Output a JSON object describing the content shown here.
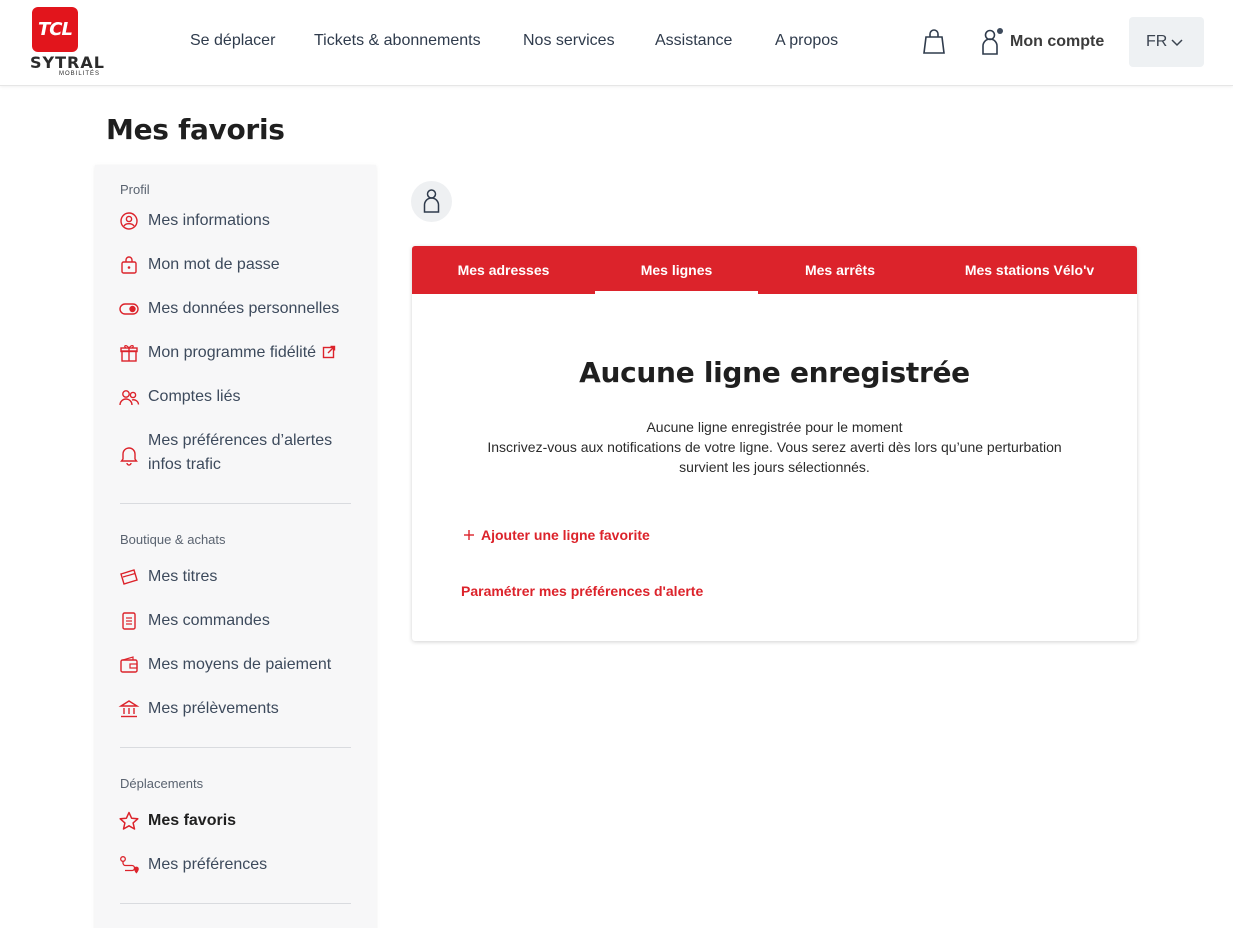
{
  "header": {
    "logo": {
      "badge": "TCL",
      "name": "SYTRAL",
      "sub": "MOBILITÉS"
    },
    "nav": [
      "Se déplacer",
      "Tickets & abonnements",
      "Nos services",
      "Assistance",
      "A propos"
    ],
    "account_label": "Mon compte",
    "lang": "FR",
    "icons": {
      "cart": "shopping-bag-icon",
      "account": "user-icon",
      "lang": "chevron-down-icon"
    }
  },
  "page": {
    "title": "Mes favoris"
  },
  "sidebar": {
    "sections": [
      {
        "label": "Profil",
        "items": [
          {
            "label": "Mes informations",
            "icon": "user-circle-icon"
          },
          {
            "label": "Mon mot de passe",
            "icon": "lock-icon"
          },
          {
            "label": "Mes données personnelles",
            "icon": "toggle-icon"
          },
          {
            "label": "Mon programme fidélité",
            "icon": "gift-icon",
            "external": true
          },
          {
            "label": "Comptes liés",
            "icon": "users-icon"
          },
          {
            "label": "Mes préférences d’alertes infos trafic",
            "line1": "Mes préférences d’alertes",
            "line2": "infos trafic",
            "icon": "bell-icon"
          }
        ]
      },
      {
        "label": "Boutique & achats",
        "items": [
          {
            "label": "Mes titres",
            "icon": "ticket-icon"
          },
          {
            "label": "Mes commandes",
            "icon": "receipt-icon"
          },
          {
            "label": "Mes moyens de paiement",
            "icon": "wallet-icon"
          },
          {
            "label": "Mes prélèvements",
            "icon": "bank-icon"
          }
        ]
      },
      {
        "label": "Déplacements",
        "items": [
          {
            "label": "Mes favoris",
            "icon": "star-icon",
            "active": true
          },
          {
            "label": "Mes préférences",
            "icon": "route-icon"
          }
        ]
      }
    ]
  },
  "main": {
    "tabs": [
      {
        "label": "Mes adresses",
        "active": false
      },
      {
        "label": "Mes lignes",
        "active": true
      },
      {
        "label": "Mes arrêts",
        "active": false
      },
      {
        "label": "Mes stations Vélo'v",
        "active": false
      }
    ],
    "empty": {
      "title": "Aucune ligne enregistrée",
      "line1": "Aucune ligne enregistrée pour le moment",
      "line2": "Inscrivez-vous aux notifications de votre ligne. Vous serez averti dès lors qu’une perturbation",
      "line3": "survient les jours sélectionnés."
    },
    "add_link": "Ajouter une ligne favorite",
    "alert_link": "Paramétrer mes préférences d'alerte"
  },
  "colors": {
    "brand_red": "#dc232b",
    "text_dark": "#1f1f1f",
    "sidebar_bg": "#f7f7f8"
  }
}
